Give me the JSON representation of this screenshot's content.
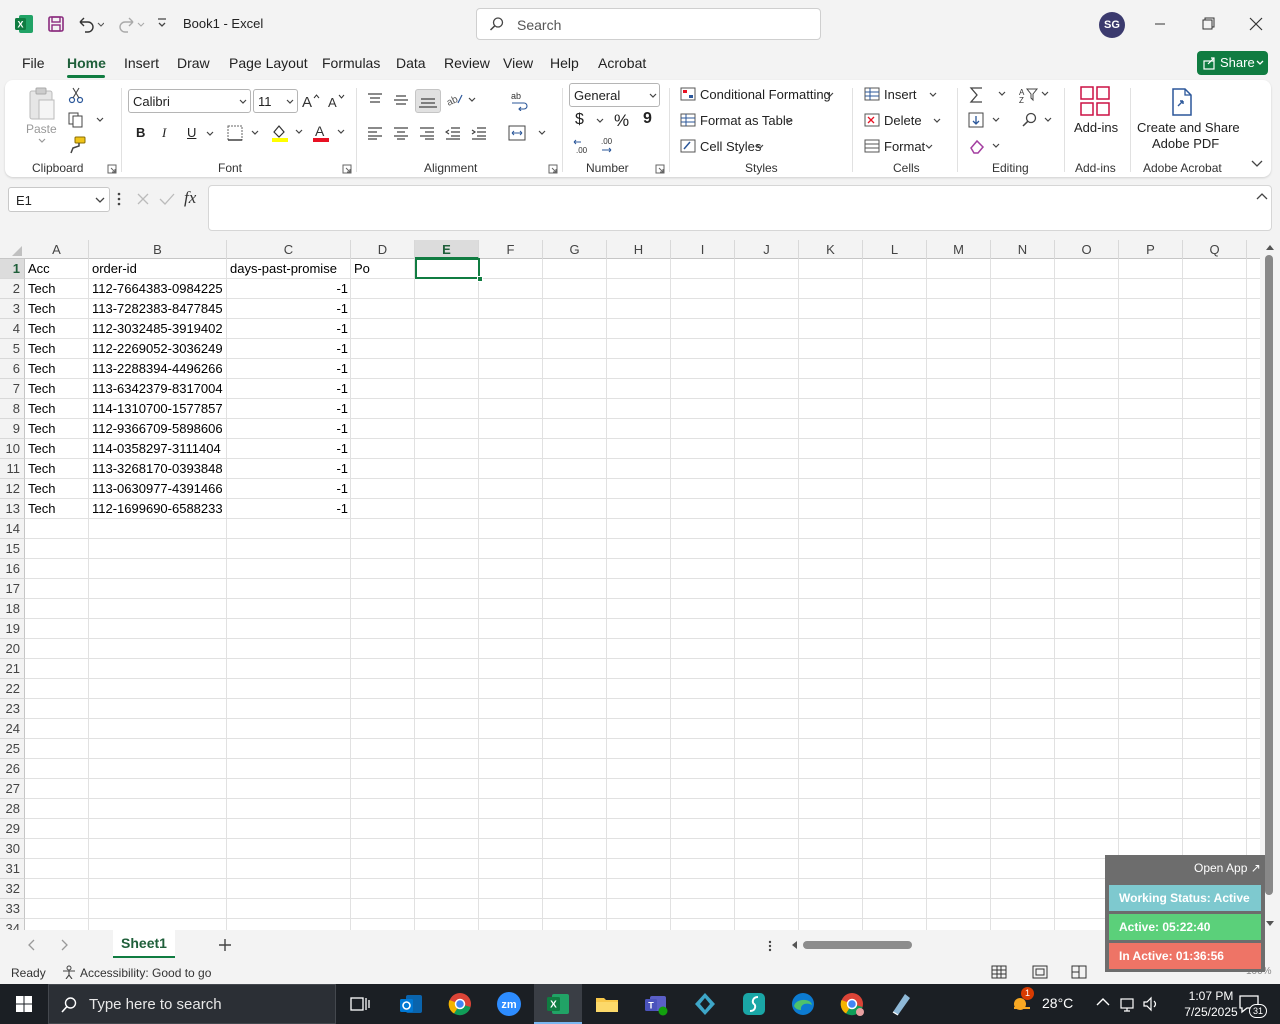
{
  "titlebar": {
    "title": "Book1  -  Excel",
    "search_placeholder": "Search",
    "avatar_initials": "SG"
  },
  "tabs": [
    "File",
    "Home",
    "Insert",
    "Draw",
    "Page Layout",
    "Formulas",
    "Data",
    "Review",
    "View",
    "Help",
    "Acrobat"
  ],
  "share_label": "Share",
  "ribbon": {
    "clipboard": {
      "paste": "Paste",
      "label": "Clipboard"
    },
    "font": {
      "name": "Calibri",
      "size": "11",
      "label": "Font",
      "bold": "B",
      "italic": "I",
      "underline": "U"
    },
    "alignment": {
      "label": "Alignment"
    },
    "number": {
      "format": "General",
      "label": "Number",
      "currency": "$",
      "percent": "%",
      "comma": "9"
    },
    "styles": {
      "conditional": "Conditional Formatting",
      "format_table": "Format as Table",
      "cell_styles": "Cell Styles",
      "label": "Styles"
    },
    "cells": {
      "insert": "Insert",
      "delete": "Delete",
      "format": "Format",
      "label": "Cells"
    },
    "editing": {
      "label": "Editing"
    },
    "addins": {
      "button": "Add-ins",
      "label": "Add-ins"
    },
    "acrobat": {
      "button_line1": "Create and Share",
      "button_line2": "Adobe PDF",
      "label": "Adobe Acrobat"
    }
  },
  "formula_bar": {
    "name_box": "E1",
    "fx": "fx",
    "formula": ""
  },
  "columns": [
    "A",
    "B",
    "C",
    "D",
    "E",
    "F",
    "G",
    "H",
    "I",
    "J",
    "K",
    "L",
    "M",
    "N",
    "O",
    "P",
    "Q"
  ],
  "rows": [
    "1",
    "2",
    "3",
    "4",
    "5",
    "6",
    "7",
    "8",
    "9",
    "10",
    "11",
    "12",
    "13",
    "14",
    "15",
    "16",
    "17",
    "18",
    "19",
    "20",
    "21",
    "22",
    "23",
    "24",
    "25",
    "26",
    "27",
    "28",
    "29",
    "30",
    "31",
    "32",
    "33",
    "34"
  ],
  "headers": [
    "Acc",
    "order-id",
    "days-past-promise",
    "Po"
  ],
  "data_rows": [
    [
      "Tech",
      "112-7664383-0984225",
      "-1"
    ],
    [
      "Tech",
      "113-7282383-8477845",
      "-1"
    ],
    [
      "Tech",
      "112-3032485-3919402",
      "-1"
    ],
    [
      "Tech",
      "112-2269052-3036249",
      "-1"
    ],
    [
      "Tech",
      "113-2288394-4496266",
      "-1"
    ],
    [
      "Tech",
      "113-6342379-8317004",
      "-1"
    ],
    [
      "Tech",
      "114-1310700-1577857",
      "-1"
    ],
    [
      "Tech",
      "112-9366709-5898606",
      "-1"
    ],
    [
      "Tech",
      "114-0358297-3111404",
      "-1"
    ],
    [
      "Tech",
      "113-3268170-0393848",
      "-1"
    ],
    [
      "Tech",
      "113-0630977-4391466",
      "-1"
    ],
    [
      "Tech",
      "112-1699690-6588233",
      "-1"
    ]
  ],
  "selected_cell": "E1",
  "sheet_tabs": [
    "Sheet1"
  ],
  "status": {
    "ready": "Ready",
    "accessibility": "Accessibility: Good to go",
    "zoom": "100%"
  },
  "overlay": {
    "open_app": "Open App ↗",
    "working_status": "Working Status: Active",
    "active": "Active: 05:22:40",
    "inactive": "In Active: 01:36:56"
  },
  "taskbar": {
    "search_placeholder": "Type here to search",
    "weather": "28°C",
    "weather_badge": "1",
    "time": "1:07 PM",
    "date": "7/25/2025",
    "notif_count": "31"
  },
  "colors": {
    "excel_green": "#107c41",
    "overlay_teal": "#7ec9cf",
    "overlay_green": "#5bd07a",
    "overlay_red": "#ee7466"
  }
}
